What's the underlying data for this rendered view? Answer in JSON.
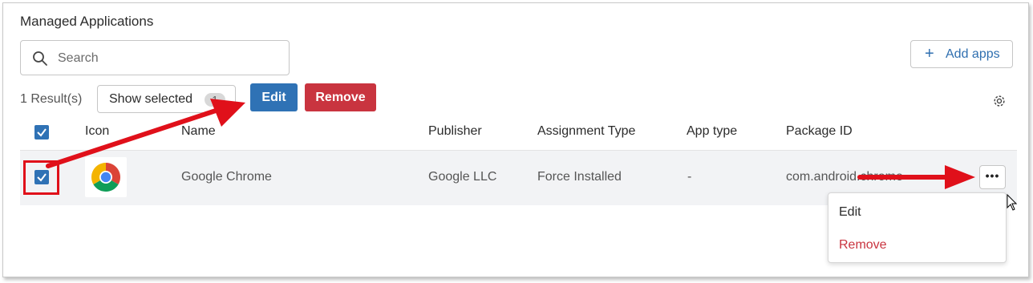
{
  "title": "Managed Applications",
  "search": {
    "placeholder": "Search"
  },
  "add_apps_label": "Add apps",
  "results_text": "1 Result(s)",
  "show_selected": {
    "label": "Show selected",
    "count": "1"
  },
  "edit_label": "Edit",
  "remove_label": "Remove",
  "columns": [
    "Icon",
    "Name",
    "Publisher",
    "Assignment Type",
    "App type",
    "Package ID"
  ],
  "row": {
    "selected": true,
    "name": "Google Chrome",
    "publisher": "Google LLC",
    "assignment_type": "Force Installed",
    "app_type": "-",
    "package_id": "com.android.chrome"
  },
  "menu": {
    "edit": "Edit",
    "remove": "Remove"
  },
  "colors": {
    "primary": "#2f72b5",
    "danger": "#c9343f",
    "annotation": "#e0101a"
  }
}
